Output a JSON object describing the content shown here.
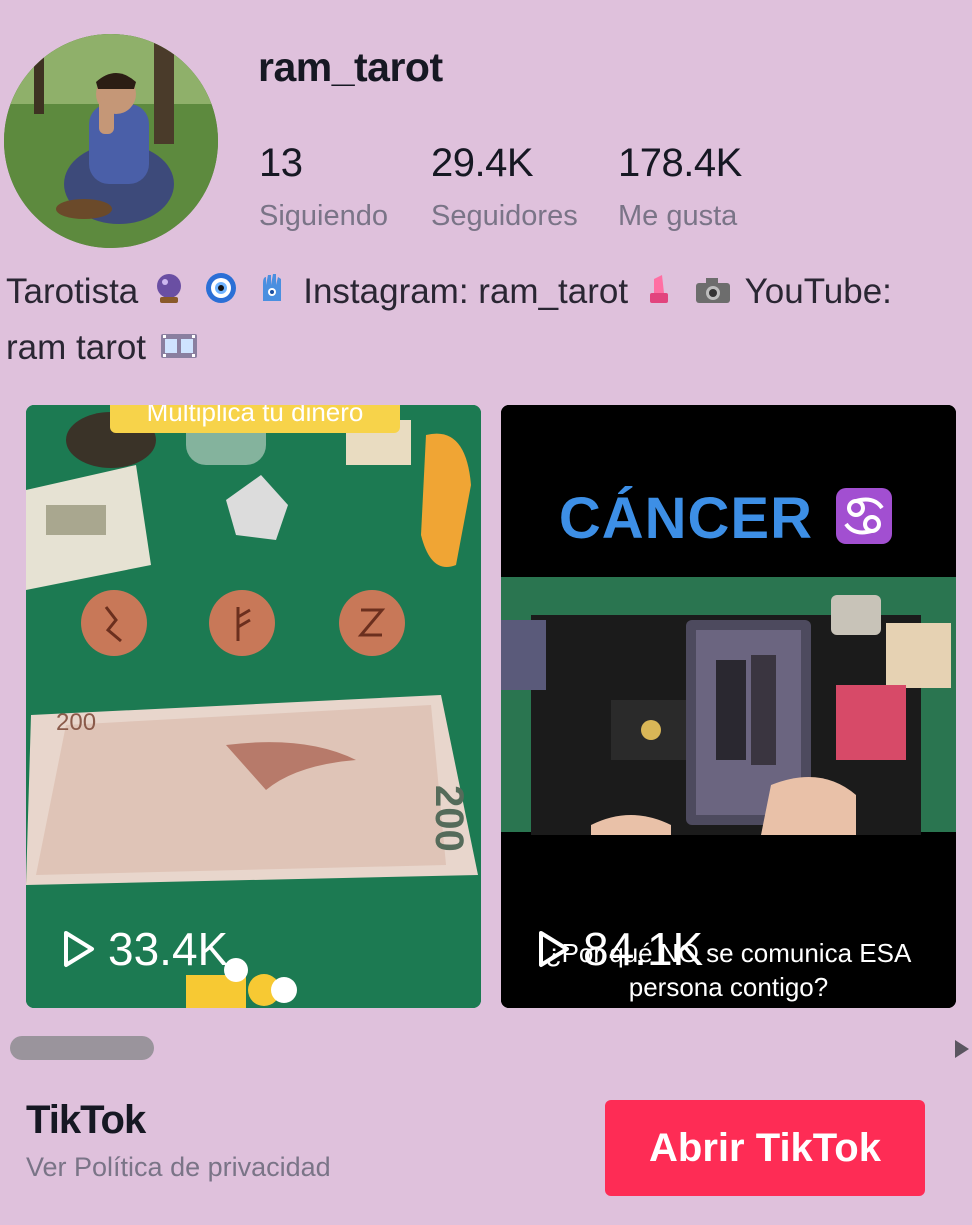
{
  "profile": {
    "username": "ram_tarot",
    "following_count": "13",
    "following_label": "Siguiendo",
    "followers_count": "29.4K",
    "followers_label": "Seguidores",
    "likes_count": "178.4K",
    "likes_label": "Me gusta",
    "bio_line1_a": "Tarotista",
    "bio_line1_b": "Instagram: ram_tarot",
    "bio_line1_c": "YouTube:",
    "bio_line2": "ram tarot"
  },
  "videos": [
    {
      "views": "33.4K",
      "banner": "Multiplica tu dinero"
    },
    {
      "views": "84.1K",
      "title": "CÁNCER",
      "caption": "¿Por qué NO se comunica ESA persona contigo?"
    }
  ],
  "footer": {
    "brand": "TikTok",
    "privacy_link": "Ver Política de privacidad",
    "open_button": "Abrir TikTok"
  },
  "colors": {
    "background": "#dfc1dc",
    "accent": "#fe2c55",
    "cancer_title": "#3d8fe6"
  }
}
